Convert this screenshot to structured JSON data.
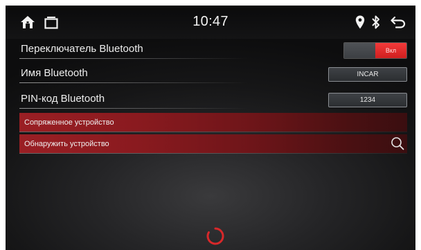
{
  "status_bar": {
    "time": "10:47",
    "left_icons": [
      "home-icon",
      "recent-apps-icon"
    ],
    "right_icons": [
      "location-pin-icon",
      "bluetooth-icon",
      "back-icon"
    ]
  },
  "settings": {
    "bluetooth_toggle": {
      "label": "Переключатель Bluetooth",
      "state_text": "Вкл",
      "on": true
    },
    "bluetooth_name": {
      "label": "Имя Bluetooth",
      "value": "INCAR"
    },
    "bluetooth_pin": {
      "label": "PIN-код Bluetooth",
      "value": "1234"
    }
  },
  "actions": {
    "paired_devices": {
      "label": "Сопряженное устройство"
    },
    "discover_devices": {
      "label": "Обнаружить устройство",
      "icon": "search-icon"
    }
  },
  "colors": {
    "accent_red": "#d01f1f",
    "row_red": "#9a1f24",
    "spinner_red": "#d8282a"
  }
}
